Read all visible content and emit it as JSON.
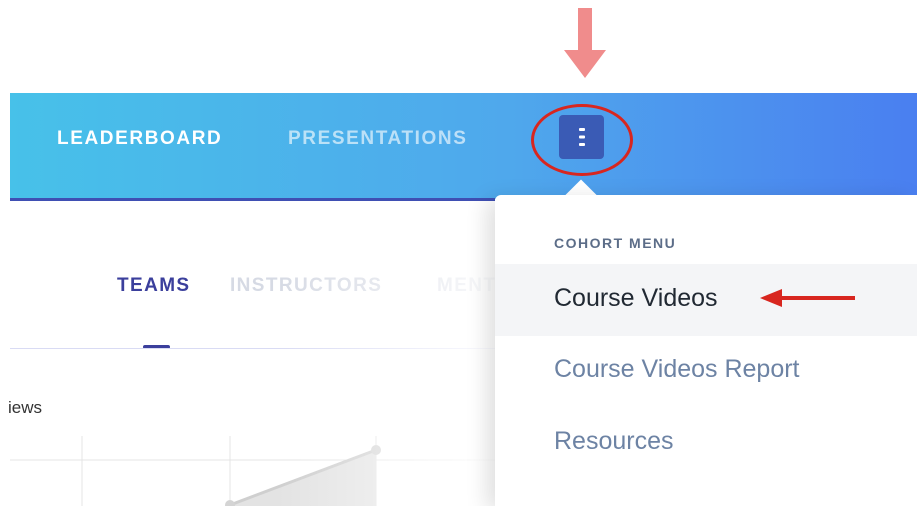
{
  "navbar": {
    "items": [
      {
        "label": "LEADERBOARD"
      },
      {
        "label": "PRESENTATIONS"
      }
    ]
  },
  "subtabs": {
    "items": [
      {
        "label": "TEAMS"
      },
      {
        "label": "INSTRUCTORS"
      },
      {
        "label": "MENTORS"
      }
    ]
  },
  "chart": {
    "title_fragment": "iews"
  },
  "dropdown": {
    "header": "COHORT MENU",
    "items": [
      {
        "label": "Course Videos"
      },
      {
        "label": "Course Videos Report"
      },
      {
        "label": "Resources"
      }
    ]
  },
  "colors": {
    "accent": "#3b3f9c",
    "annotation_red": "#d8261f",
    "arrow_pink": "#f08c8c"
  }
}
